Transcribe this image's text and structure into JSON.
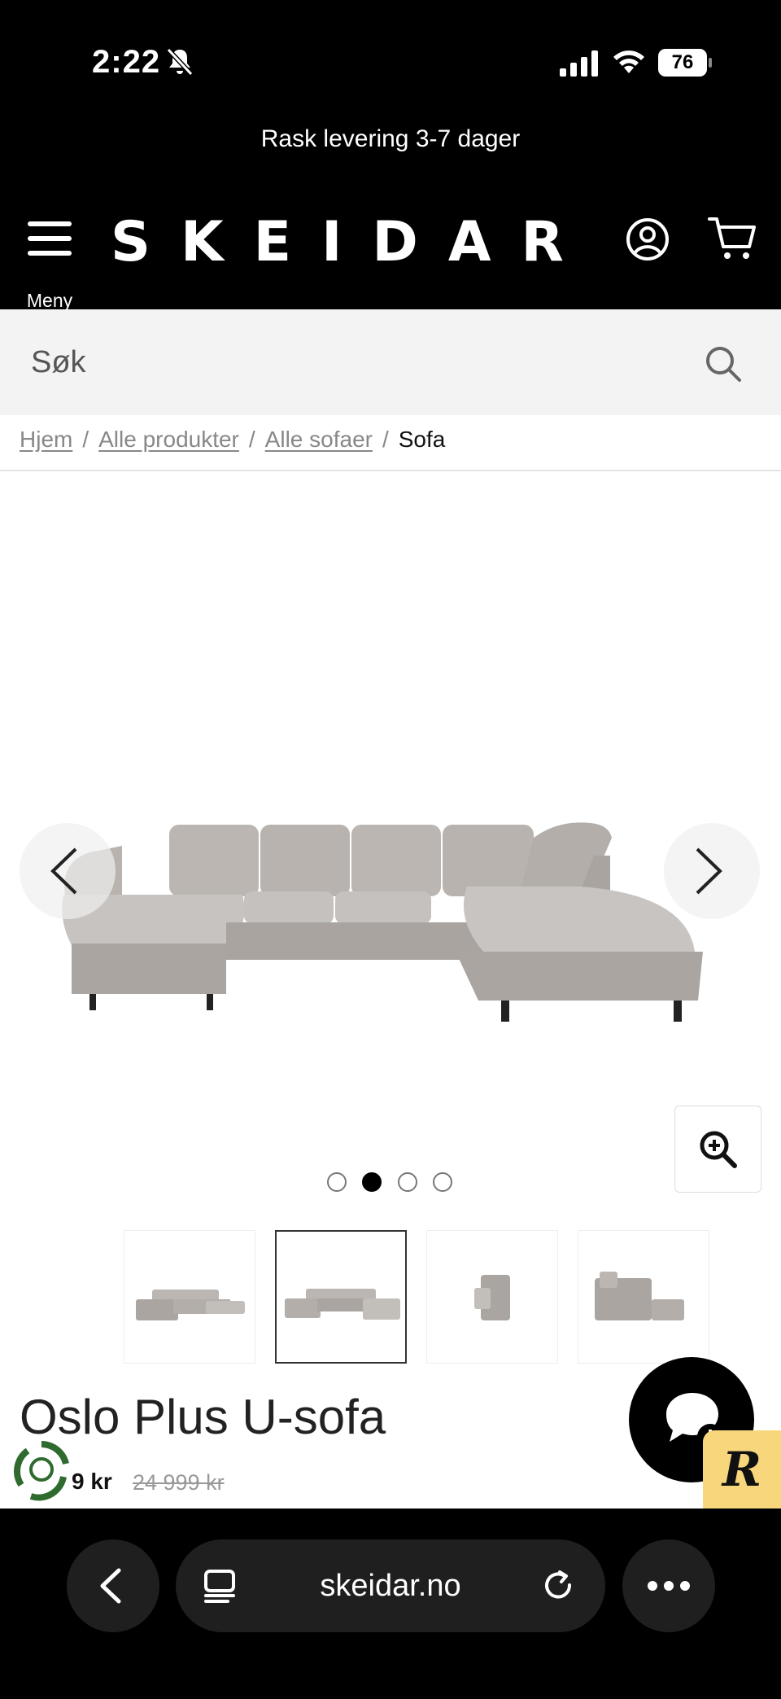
{
  "status_bar": {
    "time": "2:22",
    "battery": "76"
  },
  "promo": {
    "text": "Rask levering 3-7 dager"
  },
  "header": {
    "menu_label": "Meny",
    "logo": "SKEIDAR"
  },
  "search": {
    "placeholder": "Søk"
  },
  "breadcrumb": {
    "items": [
      "Hjem",
      "Alle produkter",
      "Alle sofaer"
    ],
    "current": "Sofa"
  },
  "gallery": {
    "active_slide": 2,
    "slide_count": 4
  },
  "product": {
    "title": "Oslo Plus U-sofa",
    "price_visible": "9 kr",
    "old_price": "24 999 kr"
  },
  "browser": {
    "url": "skeidar.no"
  },
  "badges": {
    "r_badge": "R"
  },
  "colors": {
    "header_bg": "#000000",
    "search_bg": "#f3f3f3",
    "sofa": "#bdb8b5",
    "badge_yellow": "#f8d77c"
  }
}
